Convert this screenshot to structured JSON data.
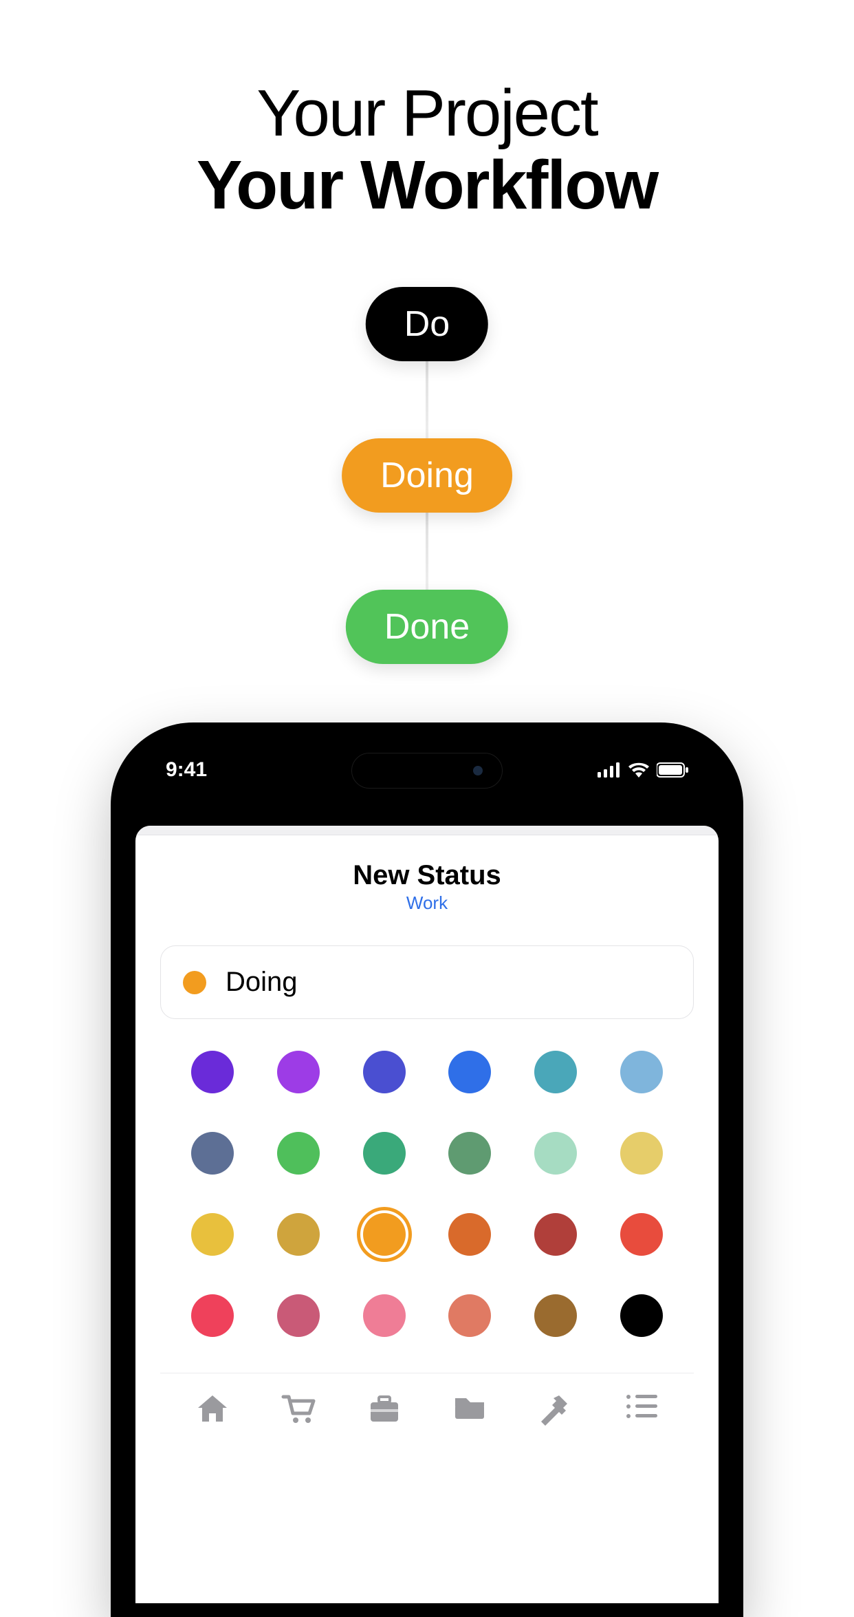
{
  "headline": {
    "line1": "Your Project",
    "line2": "Your Workflow"
  },
  "workflow": {
    "steps": [
      {
        "label": "Do",
        "color": "#000000"
      },
      {
        "label": "Doing",
        "color": "#f29c1f"
      },
      {
        "label": "Done",
        "color": "#51c459"
      }
    ]
  },
  "statusbar": {
    "time": "9:41"
  },
  "sheet": {
    "title": "New Status",
    "subtitle": "Work",
    "input": {
      "value": "Doing",
      "color": "#f29c1f"
    },
    "colors": [
      {
        "hex": "#6a2bd9",
        "selected": false
      },
      {
        "hex": "#9d3ce6",
        "selected": false
      },
      {
        "hex": "#4a4fd1",
        "selected": false
      },
      {
        "hex": "#2f6fe8",
        "selected": false
      },
      {
        "hex": "#4aa7b9",
        "selected": false
      },
      {
        "hex": "#7fb5dc",
        "selected": false
      },
      {
        "hex": "#5d6f95",
        "selected": false
      },
      {
        "hex": "#4fbf5b",
        "selected": false
      },
      {
        "hex": "#3aa97a",
        "selected": false
      },
      {
        "hex": "#5f9b71",
        "selected": false
      },
      {
        "hex": "#a6dcc2",
        "selected": false
      },
      {
        "hex": "#e6cd6a",
        "selected": false
      },
      {
        "hex": "#e8c03d",
        "selected": false
      },
      {
        "hex": "#cfa43d",
        "selected": false
      },
      {
        "hex": "#f29c1f",
        "selected": true
      },
      {
        "hex": "#d96a2b",
        "selected": false
      },
      {
        "hex": "#b03f3a",
        "selected": false
      },
      {
        "hex": "#e84c3d",
        "selected": false
      },
      {
        "hex": "#ef415b",
        "selected": false
      },
      {
        "hex": "#c95a77",
        "selected": false
      },
      {
        "hex": "#ef7d96",
        "selected": false
      },
      {
        "hex": "#e07a63",
        "selected": false
      },
      {
        "hex": "#9a6b2f",
        "selected": false
      },
      {
        "hex": "#000000",
        "selected": false
      }
    ],
    "toolbar_icons": [
      "home-icon",
      "cart-icon",
      "briefcase-icon",
      "folder-icon",
      "hammer-icon",
      "list-icon"
    ]
  }
}
